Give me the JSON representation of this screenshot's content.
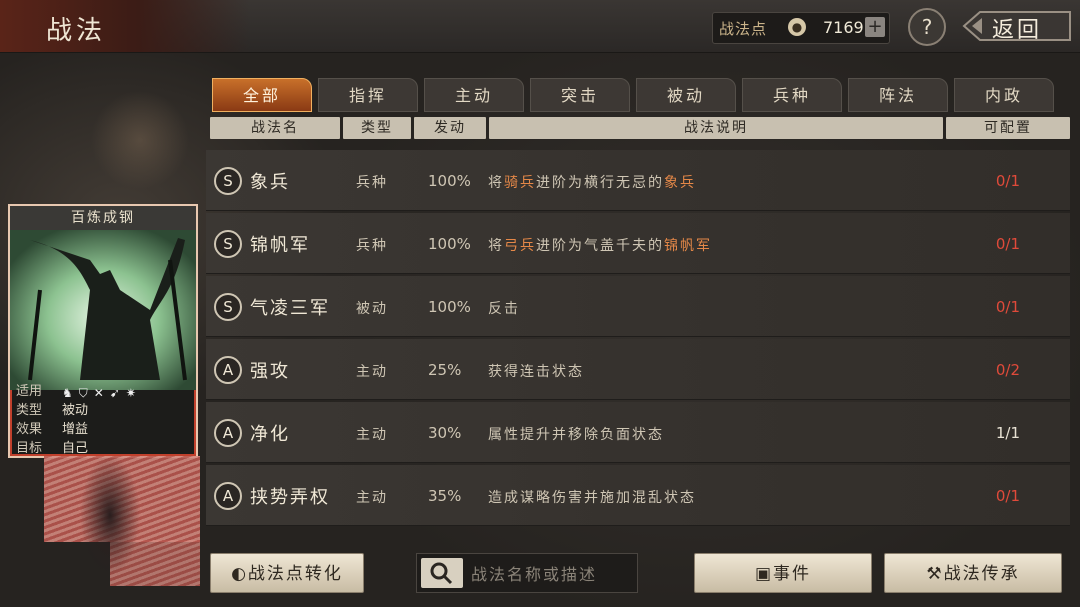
{
  "header": {
    "title": "战法",
    "points_label": "战法点",
    "points_value": "7169",
    "plus_label": "+",
    "help_label": "?",
    "back_label": "返回"
  },
  "tabs": [
    {
      "label": "全部",
      "active": true
    },
    {
      "label": "指挥",
      "active": false
    },
    {
      "label": "主动",
      "active": false
    },
    {
      "label": "突击",
      "active": false
    },
    {
      "label": "被动",
      "active": false
    },
    {
      "label": "兵种",
      "active": false
    },
    {
      "label": "阵法",
      "active": false
    },
    {
      "label": "内政",
      "active": false
    }
  ],
  "columns": {
    "name": "战法名",
    "type": "类型",
    "rate": "发动",
    "desc": "战法说明",
    "count": "可配置"
  },
  "rows": [
    {
      "grade": "S",
      "name": "象兵",
      "type": "兵种",
      "rate": "100%",
      "desc": [
        {
          "t": "将",
          "hl": false
        },
        {
          "t": "骑兵",
          "hl": true
        },
        {
          "t": "进阶为横行无忌的",
          "hl": false
        },
        {
          "t": "象兵",
          "hl": true
        }
      ],
      "count": "0/1",
      "count_color": "#e04a3a"
    },
    {
      "grade": "S",
      "name": "锦帆军",
      "type": "兵种",
      "rate": "100%",
      "desc": [
        {
          "t": "将",
          "hl": false
        },
        {
          "t": "弓兵",
          "hl": true
        },
        {
          "t": "进阶为气盖千夫的",
          "hl": false
        },
        {
          "t": "锦帆军",
          "hl": true
        }
      ],
      "count": "0/1",
      "count_color": "#e04a3a"
    },
    {
      "grade": "S",
      "name": "气凌三军",
      "type": "被动",
      "rate": "100%",
      "desc": [
        {
          "t": "反击",
          "hl": false
        }
      ],
      "count": "0/1",
      "count_color": "#e04a3a"
    },
    {
      "grade": "A",
      "name": "强攻",
      "type": "主动",
      "rate": "25%",
      "desc": [
        {
          "t": "获得连击状态",
          "hl": false
        }
      ],
      "count": "0/2",
      "count_color": "#e04a3a"
    },
    {
      "grade": "A",
      "name": "净化",
      "type": "主动",
      "rate": "30%",
      "desc": [
        {
          "t": "属性提升并移除负面状态",
          "hl": false
        }
      ],
      "count": "1/1",
      "count_color": "#e8e2d4"
    },
    {
      "grade": "A",
      "name": "挟势弄权",
      "type": "主动",
      "rate": "35%",
      "desc": [
        {
          "t": "造成谋略伤害并施加混乱状态",
          "hl": false
        }
      ],
      "count": "0/1",
      "count_color": "#e04a3a"
    }
  ],
  "card": {
    "title": "百炼成钢",
    "rows": [
      {
        "key": "适用",
        "value": ""
      },
      {
        "key": "类型",
        "value": "被动"
      },
      {
        "key": "效果",
        "value": "增益"
      },
      {
        "key": "目标",
        "value": "自己"
      }
    ],
    "unit_icons": [
      "horse-icon",
      "shield-icon",
      "bow-icon",
      "spear-icon",
      "wheel-icon"
    ]
  },
  "bottom": {
    "convert_label": "战法点转化",
    "search_placeholder": "战法名称或描述",
    "event_label": "事件",
    "inherit_label": "战法传承"
  }
}
